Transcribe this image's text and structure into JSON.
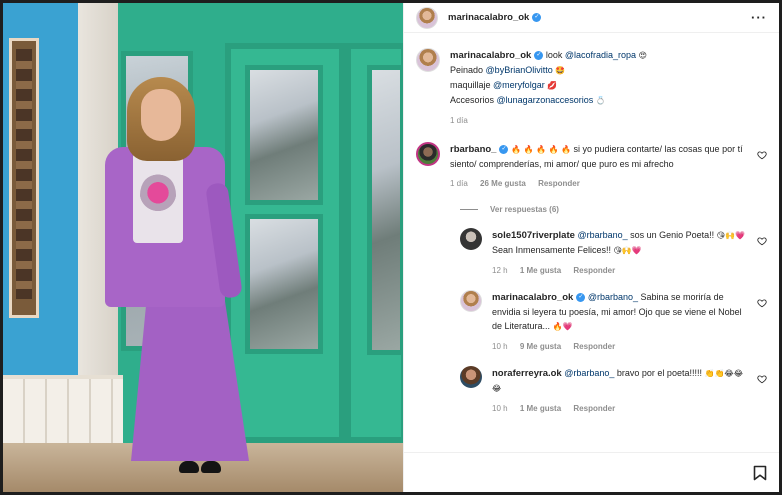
{
  "post": {
    "author": "marinacalabro_ok",
    "caption": {
      "username": "marinacalabro_ok",
      "look_label": "look",
      "look_link": "@lacofradia_ropa",
      "look_emoji": "😍",
      "hair_label": "Peinado",
      "hair_link": "@byBrianOlivitto",
      "hair_emoji": "🤩",
      "makeup_label": "maquillaje",
      "makeup_link": "@meryfolgar",
      "makeup_emoji": "💋",
      "accessories_label": "Accesorios",
      "accessories_link": "@lunagarzonaccesorios",
      "accessories_emoji": "💍",
      "time": "1 día"
    }
  },
  "comments": [
    {
      "username": "rbarbano_",
      "emojis": "🔥 🔥 🔥 🔥 🔥",
      "text": "si yo pudiera contarte/ las cosas que por tí siento/ comprenderías, mi amor/ que puro es mi afrecho",
      "time": "1 día",
      "likes": "26 Me gusta",
      "reply_label": "Responder",
      "view_replies": "Ver respuestas (6)"
    }
  ],
  "replies": [
    {
      "username": "sole1507riverplate",
      "mention": "@rbarbano_",
      "text": "sos un Genio Poeta!!",
      "emojis_a": "😘🙌💗",
      "text2": "Sean Inmensamente Felices!!",
      "emojis_b": "😘🙌💗",
      "time": "12 h",
      "likes": "1 Me gusta",
      "reply_label": "Responder"
    },
    {
      "username": "marinacalabro_ok",
      "mention": "@rbarbano_",
      "text": "Sabina se moriría de envidia si leyera tu poesía, mi amor! Ojo que se viene el Nobel de Literatura...",
      "emojis": "🔥💗",
      "time": "10 h",
      "likes": "9 Me gusta",
      "reply_label": "Responder"
    },
    {
      "username": "noraferreyra.ok",
      "mention": "@rbarbano_",
      "text": "bravo por el poeta!!!!!",
      "emojis": "👏👏😂😂😂",
      "time": "10 h",
      "likes": "1 Me gusta",
      "reply_label": "Responder"
    }
  ],
  "icons": {
    "more": "more-options-icon",
    "heart": "heart-icon",
    "bookmark": "bookmark-icon",
    "verified": "verified-badge-icon"
  },
  "colors": {
    "link": "#00376b",
    "verified": "#3797f0",
    "meta": "#8e8e8e"
  }
}
